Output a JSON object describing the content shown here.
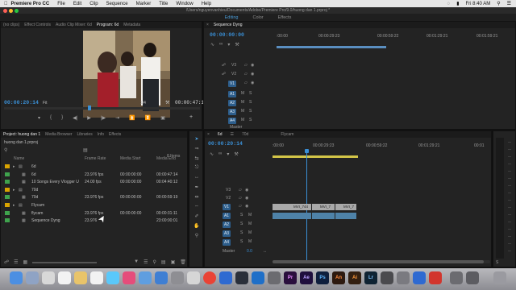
{
  "menubar": {
    "app": "Premiere Pro CC",
    "items": [
      "File",
      "Edit",
      "Clip",
      "Sequence",
      "Marker",
      "Title",
      "Window",
      "Help"
    ],
    "clock": "Fri 8:40 AM"
  },
  "titlebar": {
    "path": "/Users/nguyenvanhieu/Documents/Adobe/Premiere Pro/9.0/huong dan 1.prproj *"
  },
  "workspace": {
    "tabs": [
      "Editing",
      "Color",
      "Effects"
    ],
    "active": "Editing"
  },
  "source_monitor": {
    "tabs": [
      "(no clips)",
      "Effect Controls",
      "Audio Clip Mixer: 6d",
      "Program: 6d",
      "Metadata"
    ],
    "active_tab": "Program: 6d",
    "timecode": "00:00:20:14",
    "fit": "Fit",
    "resolution": "1/4",
    "duration": "00:00:47:15"
  },
  "sequence_top": {
    "tab": "Sequence Dyng",
    "timecode": "00:00:00:00",
    "ruler": [
      ":00:00",
      "00:00:29:23",
      "00:00:59:22",
      "00:01:29:21",
      "00:01:59:21"
    ],
    "tracks": [
      {
        "label": "V3"
      },
      {
        "label": "V2"
      },
      {
        "label": "V1"
      },
      {
        "label": "A1"
      },
      {
        "label": "A2"
      },
      {
        "label": "A3"
      },
      {
        "label": "A4"
      },
      {
        "label": "Master"
      }
    ]
  },
  "project": {
    "tabs": [
      "Project: huong dan 1",
      "Media Browser",
      "Libraries",
      "Info",
      "Effects"
    ],
    "filename": "huong dan 1.prproj",
    "count": "8 Items",
    "columns": [
      "Name",
      "Frame Rate",
      "Media Start",
      "Media End"
    ],
    "items": [
      {
        "name": "6d",
        "rate": "",
        "start": "",
        "end": "",
        "color": "#d9a400"
      },
      {
        "name": "6d",
        "rate": "23.976 fps",
        "start": "00:00:00:00",
        "end": "00:00:47:14",
        "color": "#3fa34d"
      },
      {
        "name": "10 Songs Every Vlogger U",
        "rate": "24.00 fps",
        "start": "00:00:00:00",
        "end": "00:04:40:12",
        "color": "#3fa34d"
      },
      {
        "name": "70d",
        "rate": "",
        "start": "",
        "end": "",
        "color": "#d9a400"
      },
      {
        "name": "70d",
        "rate": "23.976 fps",
        "start": "00:00:00:00",
        "end": "00:00:59:19",
        "color": "#3fa34d"
      },
      {
        "name": "Flycam",
        "rate": "",
        "start": "",
        "end": "",
        "color": "#d9a400"
      },
      {
        "name": "flycam",
        "rate": "23.976 fps",
        "start": "00:00:00:00",
        "end": "00:00:31:11",
        "color": "#3fa34d"
      },
      {
        "name": "Sequence Dyng",
        "rate": "23.976",
        "start": "",
        "end": "23:00:00:01",
        "color": "#3fa34d"
      }
    ]
  },
  "timeline": {
    "tabs": [
      "6d",
      "70d",
      "Flycam"
    ],
    "active_tab": "6d",
    "timecode": "00:00:20:14",
    "ruler": [
      ":00:00",
      "00:00:29:23",
      "00:00:59:22",
      "00:01:29:21",
      "00:01"
    ],
    "tracks": [
      {
        "label": "V3"
      },
      {
        "label": "V2"
      },
      {
        "label": "V1"
      },
      {
        "label": "A1"
      },
      {
        "label": "A2"
      },
      {
        "label": "A3"
      },
      {
        "label": "A4"
      }
    ],
    "master": {
      "label": "Master",
      "value": "0.0"
    },
    "clips": [
      "MVI_744",
      "MVI_7",
      "MVI_7"
    ]
  },
  "colors": {
    "accent": "#3a8fd5",
    "track_selected": "#2d5e8c",
    "video_clip": "#a9a9a9",
    "audio_clip": "#4e82a8"
  }
}
